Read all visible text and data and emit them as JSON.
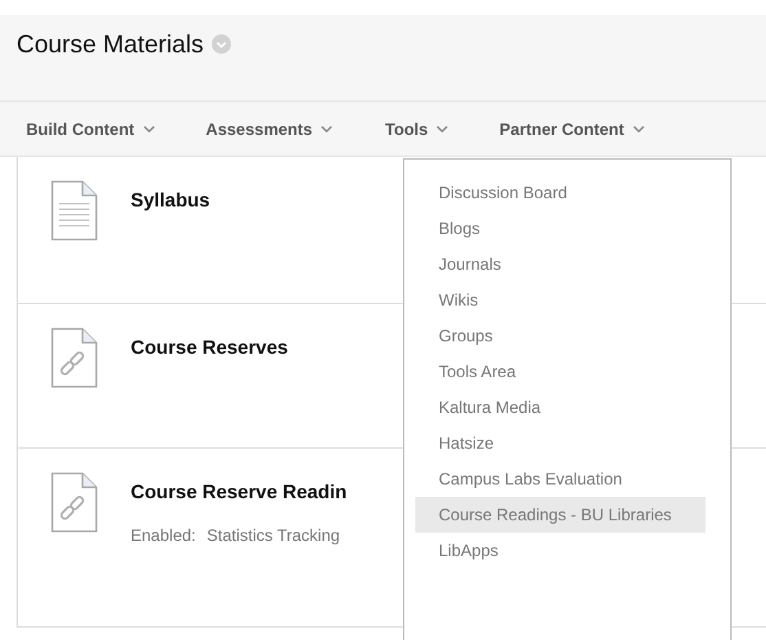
{
  "page": {
    "title": "Course Materials"
  },
  "nav": [
    {
      "label": "Build Content"
    },
    {
      "label": "Assessments"
    },
    {
      "label": "Tools"
    },
    {
      "label": "Partner Content"
    }
  ],
  "items": [
    {
      "kind": "document",
      "title": "Syllabus"
    },
    {
      "kind": "link",
      "title": "Course Reserves"
    },
    {
      "kind": "link",
      "title": "Course Reserve Readin",
      "details": [
        {
          "label": "Enabled:",
          "value": "Statistics Tracking"
        }
      ]
    }
  ],
  "tools_menu": [
    {
      "label": "Discussion Board",
      "selected": false
    },
    {
      "label": "Blogs",
      "selected": false
    },
    {
      "label": "Journals",
      "selected": false
    },
    {
      "label": "Wikis",
      "selected": false
    },
    {
      "label": "Groups",
      "selected": false
    },
    {
      "label": "Tools Area",
      "selected": false
    },
    {
      "label": "Kaltura Media",
      "selected": false
    },
    {
      "label": "Hatsize",
      "selected": false
    },
    {
      "label": "Campus Labs Evaluation",
      "selected": false
    },
    {
      "label": "Course Readings - BU Libraries",
      "selected": true
    },
    {
      "label": "LibApps",
      "selected": false
    }
  ]
}
